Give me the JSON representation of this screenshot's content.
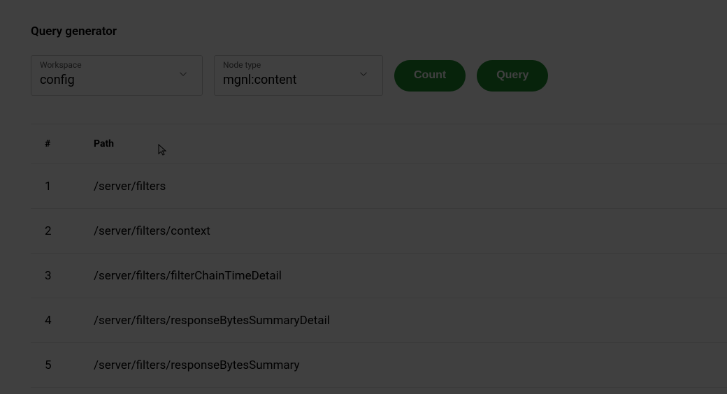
{
  "title": "Query generator",
  "workspace": {
    "label": "Workspace",
    "value": "config"
  },
  "nodetype": {
    "label": "Node type",
    "value": "mgnl:content"
  },
  "buttons": {
    "count": "Count",
    "query": "Query"
  },
  "table": {
    "headers": {
      "num": "#",
      "path": "Path"
    },
    "rows": [
      {
        "num": "1",
        "path": "/server/filters"
      },
      {
        "num": "2",
        "path": "/server/filters/context"
      },
      {
        "num": "3",
        "path": "/server/filters/filterChainTimeDetail"
      },
      {
        "num": "4",
        "path": "/server/filters/responseBytesSummaryDetail"
      },
      {
        "num": "5",
        "path": "/server/filters/responseBytesSummary"
      }
    ]
  }
}
